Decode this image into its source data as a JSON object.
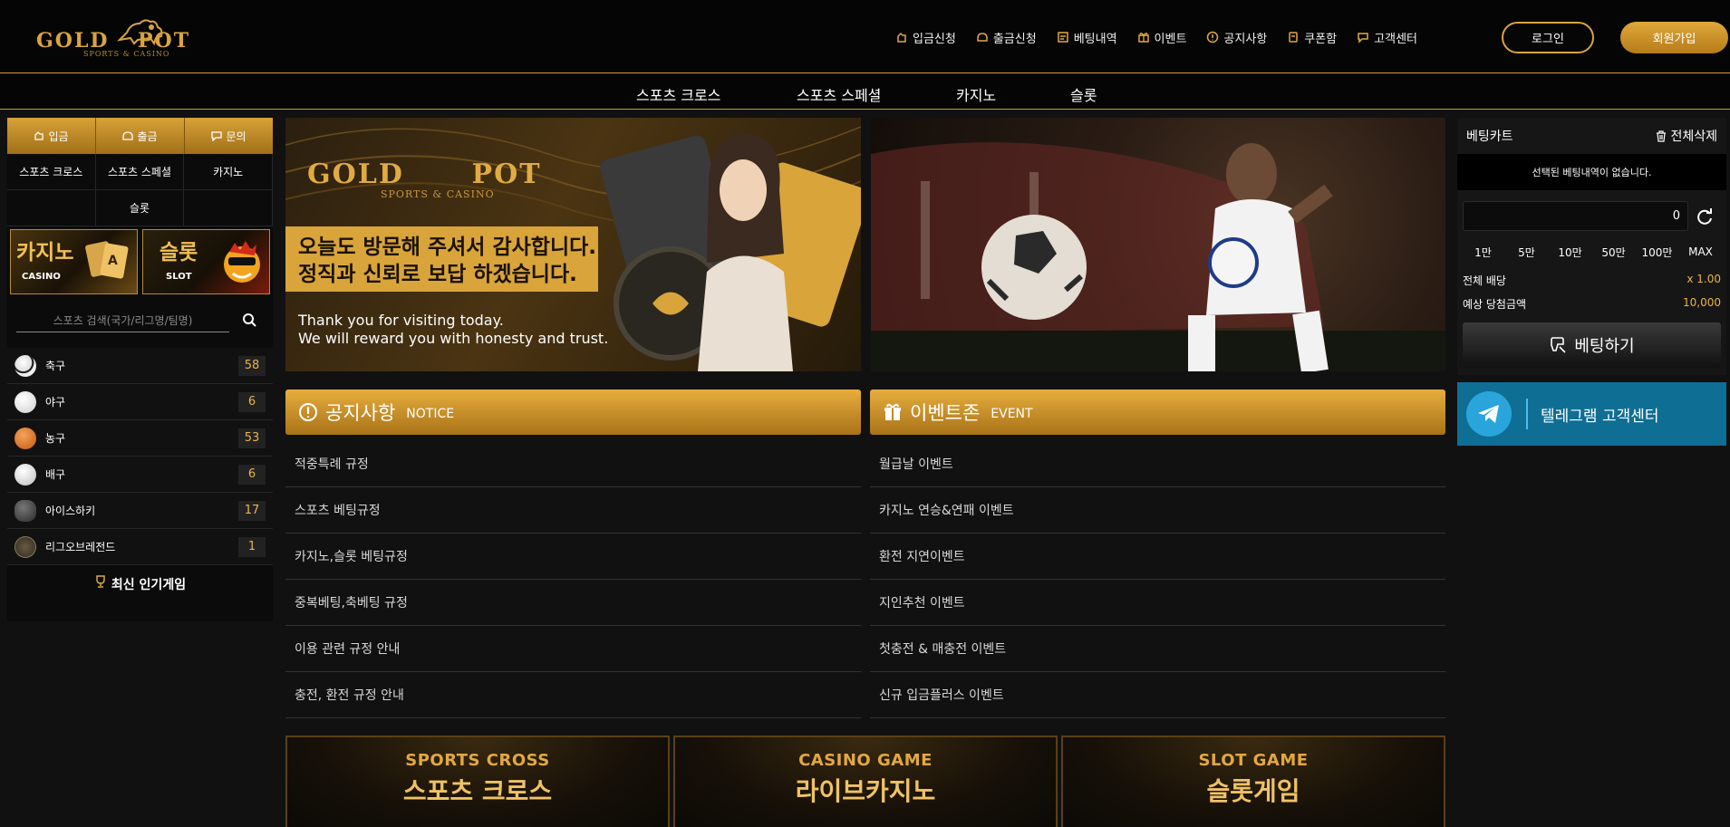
{
  "brand": {
    "word_left": "GOLD",
    "word_right": "POT",
    "subtitle": "SPORTS & CASINO"
  },
  "topnav": [
    {
      "label": "입금신청",
      "icon": "deposit-icon"
    },
    {
      "label": "출금신청",
      "icon": "withdraw-icon"
    },
    {
      "label": "베팅내역",
      "icon": "history-icon"
    },
    {
      "label": "이벤트",
      "icon": "gift-icon"
    },
    {
      "label": "공지사항",
      "icon": "notice-icon"
    },
    {
      "label": "쿠폰함",
      "icon": "coupon-icon"
    },
    {
      "label": "고객센터",
      "icon": "chat-icon"
    }
  ],
  "auth": {
    "login": "로그인",
    "join": "회원가입"
  },
  "subnav": [
    "스포츠 크로스",
    "스포츠 스페셜",
    "카지노",
    "슬롯"
  ],
  "sidebar": {
    "quick": [
      "입금",
      "출금",
      "문의"
    ],
    "categories": [
      "스포츠 크로스",
      "스포츠 스페셜",
      "카지노",
      "슬롯"
    ],
    "promo": [
      {
        "title": "카지노",
        "en": "CASINO"
      },
      {
        "title": "슬롯",
        "en": "SLOT"
      }
    ],
    "search_placeholder": "스포츠 검색(국가/리그명/팀명)",
    "sports": [
      {
        "name": "축구",
        "count": "58",
        "icon": "soccer-ball-icon"
      },
      {
        "name": "야구",
        "count": "6",
        "icon": "baseball-icon"
      },
      {
        "name": "농구",
        "count": "53",
        "icon": "basketball-icon"
      },
      {
        "name": "배구",
        "count": "6",
        "icon": "volleyball-icon"
      },
      {
        "name": "아이스하키",
        "count": "17",
        "icon": "hockey-puck-icon"
      },
      {
        "name": "리그오브레전드",
        "count": "1",
        "icon": "lol-icon"
      }
    ],
    "popular": "최신 인기게임"
  },
  "banner1": {
    "line1": "오늘도 방문해 주셔서 감사합니다.",
    "line2": "정직과 신뢰로 보답 하겠습니다.",
    "en1": "Thank you for visiting today.",
    "en2": "We will reward you with honesty and trust."
  },
  "notice": {
    "title": "공지사항",
    "en": "NOTICE",
    "items": [
      "적중특례 규정",
      "스포츠 베팅규정",
      "카지노,슬롯 베팅규정",
      "중복베팅,축베팅 규정",
      "이용 관련 규정 안내",
      "충전, 환전 규정 안내"
    ]
  },
  "event": {
    "title": "이벤트존",
    "en": "EVENT",
    "items": [
      "월급날 이벤트",
      "카지노 연승&연패 이벤트",
      "환전 지연이벤트",
      "지인추천 이벤트",
      "첫충전 & 매충전 이벤트",
      "신규 입금플러스 이벤트"
    ]
  },
  "games": [
    {
      "en": "SPORTS CROSS",
      "kr": "스포츠 크로스"
    },
    {
      "en": "CASINO GAME",
      "kr": "라이브카지노"
    },
    {
      "en": "SLOT GAME",
      "kr": "슬롯게임"
    }
  ],
  "cart": {
    "title": "베팅카트",
    "delete_all": "전체삭제",
    "empty": "선택된 베팅내역이 없습니다.",
    "amount": "0",
    "chips": [
      "1만",
      "5만",
      "10만",
      "50만",
      "100만",
      "MAX"
    ],
    "total_odds_label": "전체 배당",
    "total_odds_value": "x 1.00",
    "expected_label": "예상 당첨금액",
    "expected_value": "10,000",
    "bet_button": "베팅하기"
  },
  "telegram": {
    "label": "텔레그램 고객센터"
  },
  "colors": {
    "gold": "#d9a441",
    "telegram": "#0f6e94"
  }
}
